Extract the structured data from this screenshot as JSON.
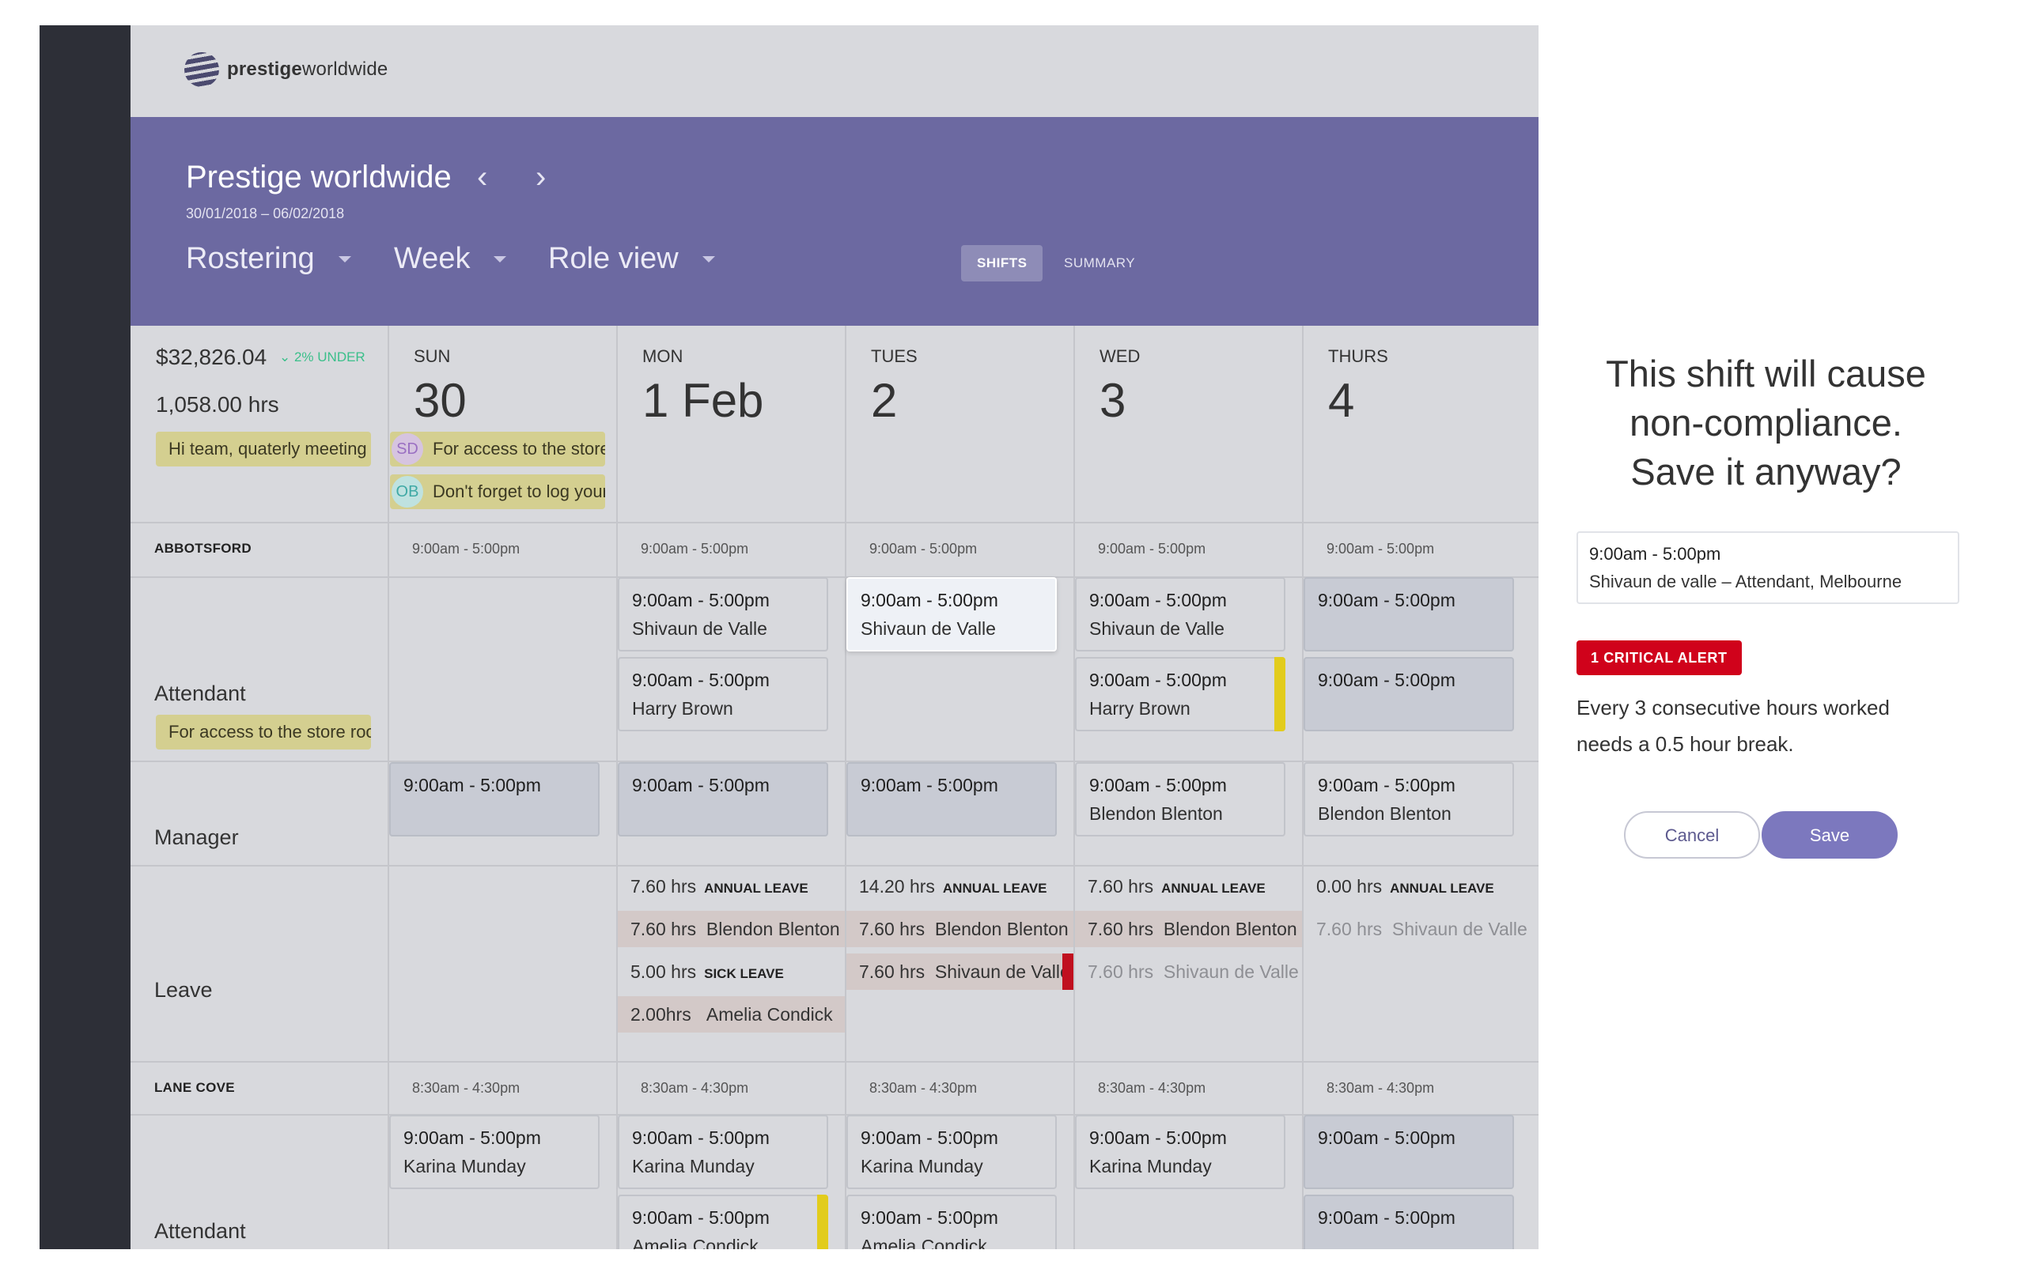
{
  "brand": {
    "strong": "prestige",
    "light": "worldwide"
  },
  "header": {
    "title": "Prestige worldwide",
    "date_range": "30/01/2018 – 06/02/2018",
    "dropdowns": [
      "Rostering",
      "Week",
      "Role view"
    ],
    "tabs": [
      "SHIFTS",
      "SUMMARY"
    ],
    "active_tab": "SHIFTS",
    "colors": {
      "header": "#6c69a1",
      "sidebar": "#2d2f37"
    }
  },
  "summary": {
    "cost": "$32,826.04",
    "variance": "2% UNDER",
    "hours": "1,058.00 hrs",
    "note": "Hi team, quaterly meeting"
  },
  "days": [
    {
      "name": "SUN",
      "num": "30"
    },
    {
      "name": "MON",
      "num": "1 Feb"
    },
    {
      "name": "TUES",
      "num": "2"
    },
    {
      "name": "WED",
      "num": "3"
    },
    {
      "name": "THURS",
      "num": "4"
    }
  ],
  "day_notes": [
    {
      "initials": "SD",
      "text": "For access to the store"
    },
    {
      "initials": "OB",
      "text": "Don't forget to log your"
    }
  ],
  "locations": [
    {
      "name": "ABBOTSFORD",
      "hours": "9:00am - 5:00pm",
      "roles": [
        {
          "name": "Attendant",
          "note": "For access to the store room"
        },
        {
          "name": "Manager"
        },
        {
          "name": "Leave"
        }
      ]
    },
    {
      "name": "LANE COVE",
      "hours": "8:30am - 4:30pm",
      "roles": [
        {
          "name": "Attendant"
        }
      ]
    }
  ],
  "shifts": {
    "time": "9:00am - 5:00pm",
    "people": {
      "shivaun": "Shivaun de Valle",
      "harry": "Harry Brown",
      "blendon": "Blendon Blenton",
      "karina": "Karina Munday",
      "amelia": "Amelia Condick"
    }
  },
  "leave": {
    "annual": "ANNUAL LEAVE",
    "sick": "SICK LEAVE",
    "mon": [
      "7.60 hrs",
      "7.60 hrs",
      "5.00 hrs",
      "2.00hrs"
    ],
    "tue": [
      "14.20 hrs",
      "7.60 hrs",
      "7.60 hrs"
    ],
    "wed": [
      "7.60 hrs",
      "7.60 hrs",
      "7.60 hrs"
    ],
    "thu": [
      "0.00 hrs",
      "7.60 hrs"
    ]
  },
  "dialog": {
    "title_lines": [
      "This shift will cause",
      "non-compliance.",
      "Save it anyway?"
    ],
    "shift_time": "9:00am - 5:00pm",
    "shift_detail": "Shivaun de valle – Attendant, Melbourne",
    "alert": "1 CRITICAL ALERT",
    "message": "Every 3 consecutive hours worked needs a 0.5 hour break.",
    "cancel": "Cancel",
    "save": "Save",
    "colors": {
      "alert": "#d0021b",
      "primary": "#7c78be",
      "warning_flag": "#e2cc1c"
    }
  }
}
